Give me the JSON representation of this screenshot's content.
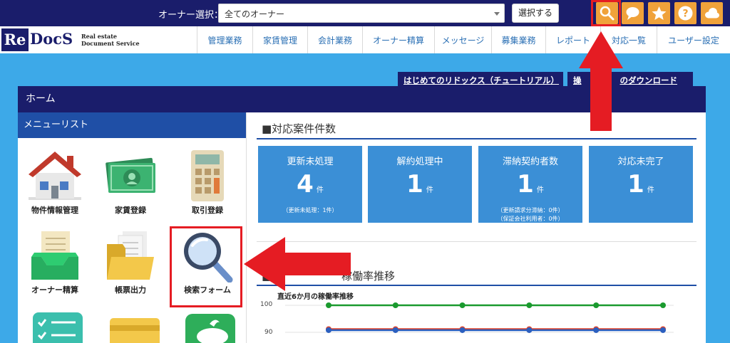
{
  "topbar": {
    "owner_label": "オーナー選択：",
    "owner_select_value": "全てのオーナー",
    "select_button": "選択する",
    "icons": [
      "search-icon",
      "chat-icon",
      "star-icon",
      "help-icon",
      "cloud-icon"
    ],
    "accent_color": "#f0a23a"
  },
  "logo": {
    "re": "Re",
    "docs": "DocS",
    "sub_line1": "Real estate",
    "sub_line2": "Document Service"
  },
  "nav": {
    "items": [
      "管理業務",
      "家賃管理",
      "会計業務",
      "オーナー精算",
      "メッセージ",
      "募集業務",
      "レポート",
      "対応一覧",
      "ユーザー設定"
    ]
  },
  "tabs": {
    "tutorial": "はじめてのリドックス（チュートリアル）",
    "download_prefix": "操",
    "download_suffix": "のダウンロード"
  },
  "panel": {
    "home_title": "ホーム",
    "menu_title": "メニューリスト",
    "menu_items": [
      {
        "label": "物件情報管理",
        "icon": "house-icon"
      },
      {
        "label": "家賃登録",
        "icon": "money-icon"
      },
      {
        "label": "取引登録",
        "icon": "calculator-icon"
      },
      {
        "label": "オーナー精算",
        "icon": "inbox-icon"
      },
      {
        "label": "帳票出力",
        "icon": "folder-icon"
      },
      {
        "label": "検索フォーム",
        "icon": "magnifier-icon"
      }
    ]
  },
  "cases": {
    "title": "■対応案件件数",
    "cards": [
      {
        "title": "更新未処理",
        "count": "4",
        "unit": "件",
        "note1": "（更新未処理：1件）",
        "note2": ""
      },
      {
        "title": "解約処理中",
        "count": "1",
        "unit": "件",
        "note1": "",
        "note2": ""
      },
      {
        "title": "滞納契約者数",
        "count": "1",
        "unit": "件",
        "note1": "（更新請求分滞納：0件）",
        "note2": "（保証会社利用者：0件）"
      },
      {
        "title": "対応未完了",
        "count": "1",
        "unit": "件",
        "note1": "",
        "note2": ""
      }
    ]
  },
  "occupancy": {
    "title_left": "■直",
    "title_right": "稼働率推移"
  },
  "chart_data": {
    "type": "line",
    "title": "直近6か月の稼働率推移",
    "x": [
      1,
      2,
      3,
      4,
      5,
      6
    ],
    "series": [
      {
        "values": [
          100,
          100,
          100,
          100,
          100,
          100
        ],
        "color": "#1a9a2e"
      },
      {
        "values": [
          91.2,
          91.2,
          91.2,
          91.2,
          91.2,
          91.2
        ],
        "color": "#e0442b"
      },
      {
        "values": [
          90.8,
          90.8,
          90.8,
          90.8,
          90.8,
          90.8
        ],
        "color": "#2b5fbf"
      }
    ],
    "yticks": [
      "100",
      "90"
    ],
    "ylim": [
      88,
      102
    ]
  }
}
